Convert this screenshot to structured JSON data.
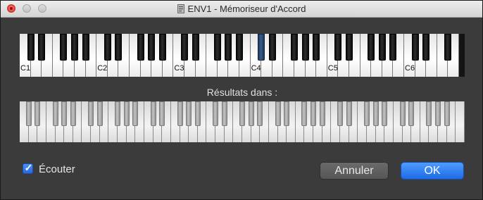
{
  "window": {
    "title": "ENV1 - Mémoriseur d'Accord"
  },
  "top_keyboard": {
    "octave_labels": [
      "C1",
      "C2",
      "C3",
      "C4",
      "C5",
      "C6"
    ],
    "selected_note": "C#4"
  },
  "results": {
    "label": "Résultats dans :"
  },
  "listen": {
    "label": "Écouter",
    "checked": true
  },
  "buttons": {
    "cancel_label": "Annuler",
    "ok_label": "OK"
  },
  "colors": {
    "accent": "#2f7cf6",
    "selected_key": "#34557f"
  }
}
